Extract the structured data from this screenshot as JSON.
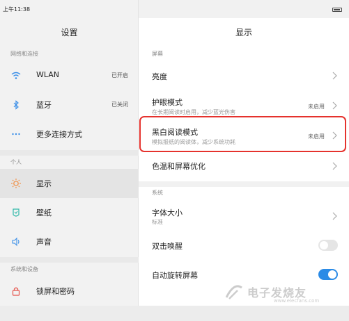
{
  "status": {
    "time": "上午11:38"
  },
  "left": {
    "title": "设置",
    "section_network": "网络和连接",
    "section_personal": "个人",
    "section_system": "系统和设备",
    "items": [
      {
        "label": "WLAN",
        "value": "已开启",
        "icon": "wifi-icon"
      },
      {
        "label": "蓝牙",
        "value": "已关闭",
        "icon": "bluetooth-icon"
      },
      {
        "label": "更多连接方式",
        "value": "",
        "icon": "more-dots-icon"
      },
      {
        "label": "显示",
        "value": "",
        "icon": "sun-icon"
      },
      {
        "label": "壁纸",
        "value": "",
        "icon": "wallpaper-icon"
      },
      {
        "label": "声音",
        "value": "",
        "icon": "speaker-icon"
      },
      {
        "label": "锁屏和密码",
        "value": "",
        "icon": "lock-icon"
      }
    ]
  },
  "right": {
    "title": "显示",
    "section_screen": "屏幕",
    "section_system": "系统",
    "brightness": {
      "label": "亮度"
    },
    "eye_protect": {
      "label": "护眼模式",
      "sub": "在长期阅读时启用，减少蓝光伤害",
      "value": "未启用"
    },
    "bw_read": {
      "label": "黑白阅读模式",
      "sub": "模拟报纸的阅读体，减少系统功耗",
      "value": "未启用"
    },
    "color_temp": {
      "label": "色温和屏幕优化"
    },
    "font_size": {
      "label": "字体大小",
      "sub": "标准"
    },
    "double_tap": {
      "label": "双击唤醒",
      "enabled": false
    },
    "auto_rotate": {
      "label": "自动旋转屏幕",
      "enabled": true
    }
  },
  "watermark": {
    "text": "电子发烧友",
    "site": "www.elecfans.com"
  },
  "colors": {
    "accent": "#2b8be6",
    "highlight": "#e5322d",
    "icon_teal": "#2fb8a8",
    "icon_orange": "#f28b3c",
    "icon_red": "#e5534b",
    "icon_blue": "#3b8fe8"
  }
}
